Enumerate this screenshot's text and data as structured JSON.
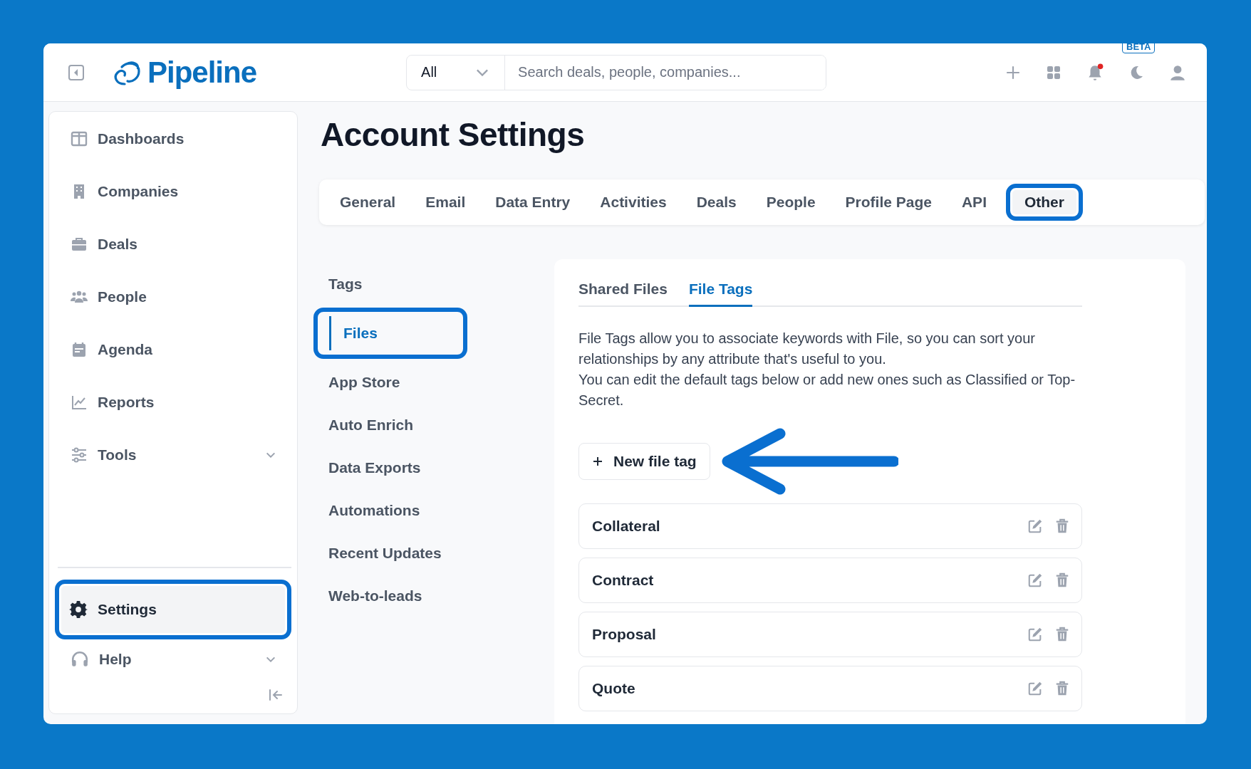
{
  "header": {
    "logo": "Pipeline",
    "search_scope": "All",
    "search_placeholder": "Search deals, people, companies...",
    "beta_badge": "BETA",
    "notifications_unread": true
  },
  "sidebar": {
    "items": [
      {
        "label": "Dashboards",
        "expandable": false,
        "selected": false
      },
      {
        "label": "Companies",
        "expandable": false,
        "selected": false
      },
      {
        "label": "Deals",
        "expandable": false,
        "selected": false
      },
      {
        "label": "People",
        "expandable": false,
        "selected": false
      },
      {
        "label": "Agenda",
        "expandable": false,
        "selected": false
      },
      {
        "label": "Reports",
        "expandable": false,
        "selected": false
      },
      {
        "label": "Tools",
        "expandable": true,
        "selected": false
      }
    ],
    "bottom_items": [
      {
        "label": "Settings",
        "expandable": false,
        "selected": true
      },
      {
        "label": "Help",
        "expandable": true,
        "selected": false
      }
    ]
  },
  "page_title": "Account Settings",
  "tabs": [
    {
      "label": "General",
      "selected": false
    },
    {
      "label": "Email",
      "selected": false
    },
    {
      "label": "Data Entry",
      "selected": false
    },
    {
      "label": "Activities",
      "selected": false
    },
    {
      "label": "Deals",
      "selected": false
    },
    {
      "label": "People",
      "selected": false
    },
    {
      "label": "Profile Page",
      "selected": false
    },
    {
      "label": "API",
      "selected": false
    },
    {
      "label": "Other",
      "selected": true
    }
  ],
  "subnav": [
    {
      "label": "Tags",
      "selected": false
    },
    {
      "label": "Files",
      "selected": true
    },
    {
      "label": "App Store",
      "selected": false
    },
    {
      "label": "Auto Enrich",
      "selected": false
    },
    {
      "label": "Data Exports",
      "selected": false
    },
    {
      "label": "Automations",
      "selected": false
    },
    {
      "label": "Recent Updates",
      "selected": false
    },
    {
      "label": "Web-to-leads",
      "selected": false
    }
  ],
  "panel": {
    "subtabs": [
      {
        "label": "Shared Files",
        "selected": false
      },
      {
        "label": "File Tags",
        "selected": true
      }
    ],
    "description": [
      "File Tags allow you to associate keywords with File, so you can sort your relationships by any attribute that's useful to you.",
      "You can edit the default tags below or add new ones such as Classified or Top-Secret."
    ],
    "new_button": "New file tag",
    "tags": [
      {
        "name": "Collateral"
      },
      {
        "name": "Contract"
      },
      {
        "name": "Proposal"
      },
      {
        "name": "Quote"
      }
    ]
  }
}
